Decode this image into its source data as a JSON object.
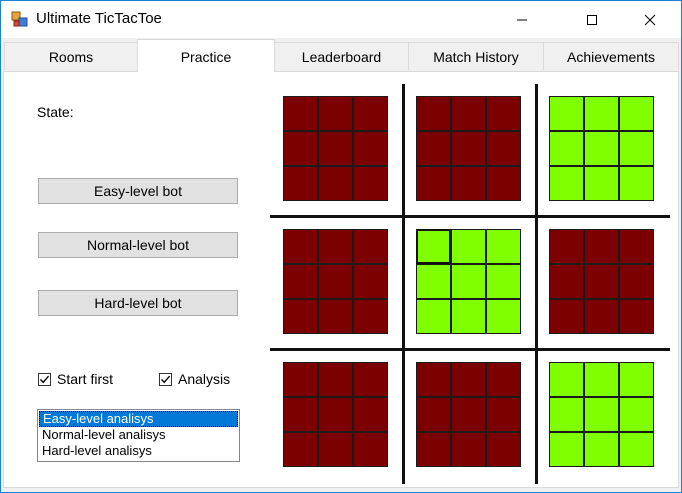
{
  "window": {
    "title": "Ultimate TicTacToe"
  },
  "tabs": [
    {
      "label": "Rooms",
      "active": false
    },
    {
      "label": "Practice",
      "active": true
    },
    {
      "label": "Leaderboard",
      "active": false
    },
    {
      "label": "Match History",
      "active": false
    },
    {
      "label": "Achievements",
      "active": false
    }
  ],
  "practice": {
    "state_label": "State:",
    "buttons": {
      "easy": "Easy-level bot",
      "normal": "Normal-level bot",
      "hard": "Hard-level bot"
    },
    "checkboxes": {
      "start_first": {
        "label": "Start first",
        "checked": true
      },
      "analysis": {
        "label": "Analysis",
        "checked": true
      }
    },
    "analysis_list": {
      "items": [
        "Easy-level analisys",
        "Normal-level analisys",
        "Hard-level analisys"
      ],
      "selected_index": 0
    }
  },
  "colors": {
    "inactive_board": "#7d0000",
    "active_board": "#80ff00",
    "accent": "#0078d7"
  },
  "board": {
    "rows": [
      [
        "inactive",
        "inactive",
        "active"
      ],
      [
        "inactive",
        "active",
        "inactive"
      ],
      [
        "inactive",
        "inactive",
        "active"
      ]
    ],
    "highlight": {
      "board_row": 1,
      "board_col": 1,
      "cell_row": 0,
      "cell_col": 0
    }
  }
}
